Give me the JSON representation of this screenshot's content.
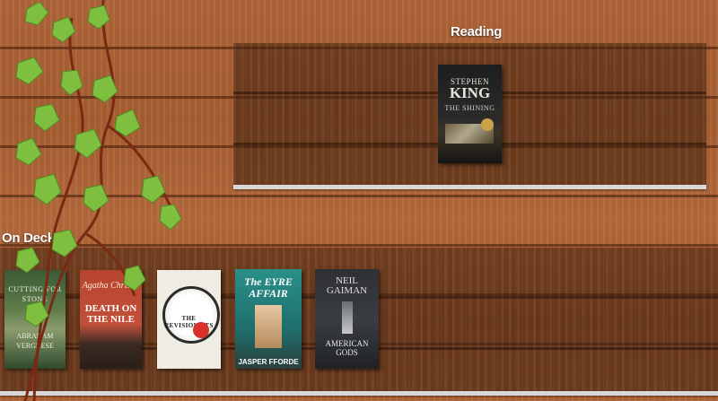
{
  "sections": {
    "reading_label": "Reading",
    "ondeck_label": "On Deck"
  },
  "reading": [
    {
      "author": "STEPHEN",
      "author2": "KING",
      "title": "THE SHINING",
      "color": "#1a1a1a"
    }
  ],
  "on_deck": [
    {
      "title": "CUTTING FOR STONE",
      "author": "ABRAHAM VERGHESE",
      "color": "#3f5e3a"
    },
    {
      "brand": "Agatha Christie",
      "title": "DEATH ON THE NILE",
      "color": "#b4402b"
    },
    {
      "title": "THE REVISIONISTS",
      "color": "#f1ede4"
    },
    {
      "title": "The EYRE AFFAIR",
      "author": "JASPER FFORDE",
      "color": "#2a8a86"
    },
    {
      "author": "NEIL GAIMAN",
      "title": "AMERICAN GODS",
      "color": "#2b2d31"
    }
  ]
}
